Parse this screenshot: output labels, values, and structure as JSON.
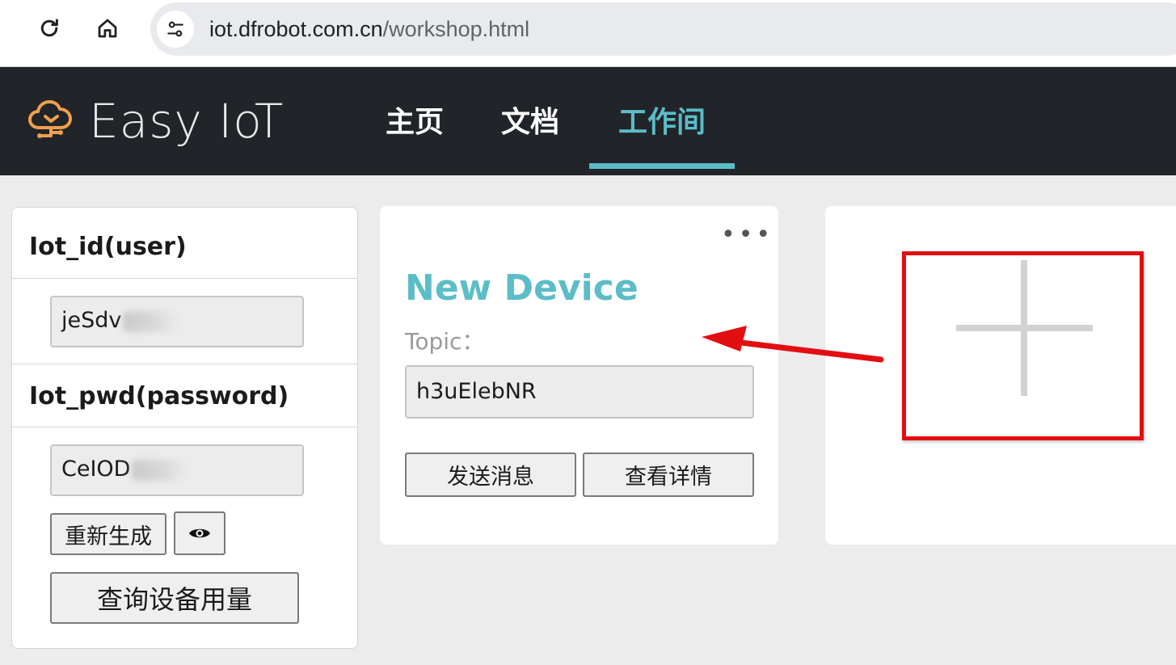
{
  "browser": {
    "url_host": "iot.dfrobot.com.cn",
    "url_path": "/workshop.html",
    "reload_icon": "reload-icon",
    "home_icon": "home-icon",
    "site_settings_icon": "tune-icon"
  },
  "navbar": {
    "logo_text": "Easy IoT",
    "logo_icon": "cloud-tree-icon",
    "items": [
      {
        "label": "主页",
        "active": false
      },
      {
        "label": "文档",
        "active": false
      },
      {
        "label": "工作间",
        "active": true
      }
    ],
    "accent_color": "#5bbdc7"
  },
  "account": {
    "id_label": "Iot_id(user)",
    "id_value": "jeSdv",
    "pwd_label": "Iot_pwd(password)",
    "pwd_value": "CeIOD",
    "regenerate_label": "重新生成",
    "reveal_icon": "eye-icon",
    "query_usage_label": "查询设备用量"
  },
  "device": {
    "more_label": "•••",
    "name": "New Device",
    "topic_label": "Topic：",
    "topic_value": "h3uElebNR",
    "send_label": "发送消息",
    "details_label": "查看详情"
  },
  "add_device": {
    "icon": "plus-icon",
    "annotation_color": "#e30e12"
  }
}
